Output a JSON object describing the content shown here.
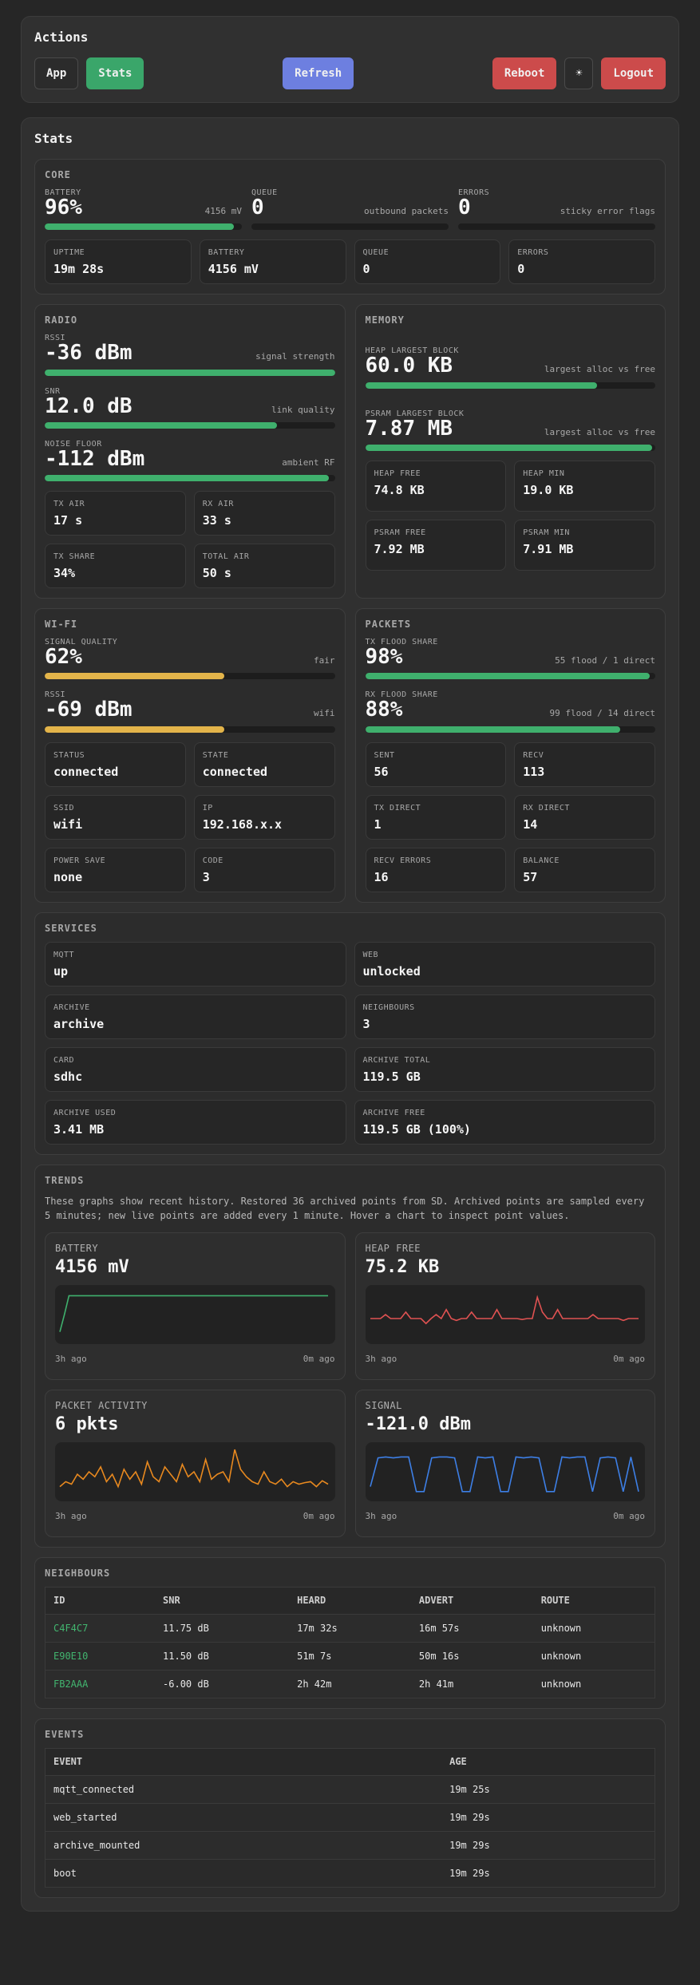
{
  "actions": {
    "title": "Actions",
    "buttons": {
      "app": "App",
      "stats": "Stats",
      "refresh": "Refresh",
      "reboot": "Reboot",
      "theme": "☀",
      "logout": "Logout"
    }
  },
  "stats": {
    "title": "Stats",
    "core": {
      "title": "CORE",
      "battery": {
        "label": "BATTERY",
        "value": "96%",
        "note": "4156 mV",
        "fill": 0.96
      },
      "queue": {
        "label": "QUEUE",
        "value": "0",
        "note": "outbound packets",
        "fill": 0
      },
      "errors": {
        "label": "ERRORS",
        "value": "0",
        "note": "sticky error flags",
        "fill": 0
      },
      "cards": [
        {
          "label": "UPTIME",
          "value": "19m 28s"
        },
        {
          "label": "BATTERY",
          "value": "4156 mV"
        },
        {
          "label": "QUEUE",
          "value": "0"
        },
        {
          "label": "ERRORS",
          "value": "0"
        }
      ]
    },
    "radio": {
      "title": "RADIO",
      "rssi": {
        "label": "RSSI",
        "value": "-36 dBm",
        "note": "signal strength",
        "fill": 1.0
      },
      "snr": {
        "label": "SNR",
        "value": "12.0 dB",
        "note": "link quality",
        "fill": 0.8
      },
      "noise": {
        "label": "NOISE FLOOR",
        "value": "-112 dBm",
        "note": "ambient RF",
        "fill": 0.98
      },
      "cards": [
        {
          "label": "TX AIR",
          "value": "17 s"
        },
        {
          "label": "RX AIR",
          "value": "33 s"
        },
        {
          "label": "TX SHARE",
          "value": "34%"
        },
        {
          "label": "TOTAL AIR",
          "value": "50 s"
        }
      ]
    },
    "memory": {
      "title": "MEMORY",
      "heap_block": {
        "label": "HEAP LARGEST BLOCK",
        "value": "60.0 KB",
        "note": "largest alloc vs free",
        "fill": 0.8
      },
      "psram_block": {
        "label": "PSRAM LARGEST BLOCK",
        "value": "7.87 MB",
        "note": "largest alloc vs free",
        "fill": 0.99
      },
      "cards": [
        {
          "label": "HEAP FREE",
          "value": "74.8 KB"
        },
        {
          "label": "HEAP MIN",
          "value": "19.0 KB"
        },
        {
          "label": "PSRAM FREE",
          "value": "7.92 MB"
        },
        {
          "label": "PSRAM MIN",
          "value": "7.91 MB"
        }
      ]
    },
    "wifi": {
      "title": "WI-FI",
      "quality": {
        "label": "SIGNAL QUALITY",
        "value": "62%",
        "note": "fair",
        "fill": 0.62
      },
      "rssi": {
        "label": "RSSI",
        "value": "-69 dBm",
        "note": "wifi",
        "fill": 0.62
      },
      "cards": [
        {
          "label": "STATUS",
          "value": "connected"
        },
        {
          "label": "STATE",
          "value": "connected"
        },
        {
          "label": "SSID",
          "value": "wifi"
        },
        {
          "label": "IP",
          "value": "192.168.x.x"
        },
        {
          "label": "POWER SAVE",
          "value": "none"
        },
        {
          "label": "CODE",
          "value": "3"
        }
      ]
    },
    "packets": {
      "title": "PACKETS",
      "tx_flood": {
        "label": "TX FLOOD SHARE",
        "value": "98%",
        "note": "55 flood / 1 direct",
        "fill": 0.98
      },
      "rx_flood": {
        "label": "RX FLOOD SHARE",
        "value": "88%",
        "note": "99 flood / 14 direct",
        "fill": 0.88
      },
      "cards": [
        {
          "label": "SENT",
          "value": "56"
        },
        {
          "label": "RECV",
          "value": "113"
        },
        {
          "label": "TX DIRECT",
          "value": "1"
        },
        {
          "label": "RX DIRECT",
          "value": "14"
        },
        {
          "label": "RECV ERRORS",
          "value": "16"
        },
        {
          "label": "BALANCE",
          "value": "57"
        }
      ]
    },
    "services": {
      "title": "SERVICES",
      "cards": [
        {
          "label": "MQTT",
          "value": "up"
        },
        {
          "label": "WEB",
          "value": "unlocked"
        },
        {
          "label": "ARCHIVE",
          "value": "archive"
        },
        {
          "label": "NEIGHBOURS",
          "value": "3"
        },
        {
          "label": "CARD",
          "value": "sdhc"
        },
        {
          "label": "ARCHIVE TOTAL",
          "value": "119.5 GB"
        },
        {
          "label": "ARCHIVE USED",
          "value": "3.41 MB"
        },
        {
          "label": "ARCHIVE FREE",
          "value": "119.5 GB (100%)"
        }
      ]
    },
    "trends": {
      "title": "TRENDS",
      "description": "These graphs show recent history. Restored 36 archived points from SD. Archived points are sampled every 5 minutes; new live points are added every 1 minute. Hover a chart to inspect point values.",
      "charts": [
        {
          "label": "BATTERY",
          "value": "4156 mV",
          "start": "3h ago",
          "end": "0m ago",
          "color": "#3fb06d"
        },
        {
          "label": "HEAP FREE",
          "value": "75.2 KB",
          "start": "3h ago",
          "end": "0m ago",
          "color": "#e05252"
        },
        {
          "label": "PACKET ACTIVITY",
          "value": "6 pkts",
          "start": "3h ago",
          "end": "0m ago",
          "color": "#e8891f"
        },
        {
          "label": "SIGNAL",
          "value": "-121.0 dBm",
          "start": "3h ago",
          "end": "0m ago",
          "color": "#3d7fe6"
        }
      ]
    },
    "neighbours": {
      "title": "NEIGHBOURS",
      "columns": [
        "ID",
        "SNR",
        "HEARD",
        "ADVERT",
        "ROUTE"
      ],
      "rows": [
        [
          "C4F4C7",
          "11.75 dB",
          "17m 32s",
          "16m 57s",
          "unknown"
        ],
        [
          "E90E10",
          "11.50 dB",
          "51m 7s",
          "50m 16s",
          "unknown"
        ],
        [
          "FB2AAA",
          "-6.00 dB",
          "2h 42m",
          "2h 41m",
          "unknown"
        ]
      ]
    },
    "events": {
      "title": "EVENTS",
      "columns": [
        "EVENT",
        "AGE"
      ],
      "rows": [
        [
          "mqtt_connected",
          "19m 25s"
        ],
        [
          "web_started",
          "19m 29s"
        ],
        [
          "archive_mounted",
          "19m 29s"
        ],
        [
          "boot",
          "19m 29s"
        ]
      ]
    }
  }
}
